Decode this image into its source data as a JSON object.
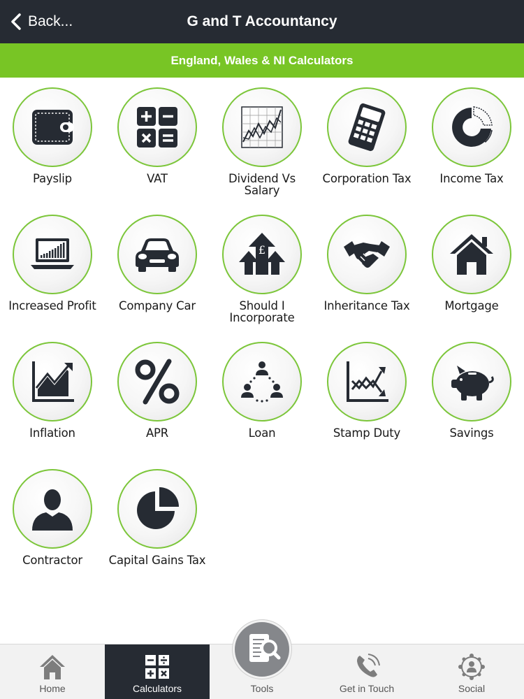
{
  "header": {
    "back_label": "Back...",
    "title": "G and T Accountancy"
  },
  "section": {
    "title": "England, Wales & NI Calculators"
  },
  "calculators": [
    {
      "label": "Payslip",
      "icon": "wallet-icon"
    },
    {
      "label": "VAT",
      "icon": "calculator-symbols-icon"
    },
    {
      "label": "Dividend Vs Salary",
      "icon": "line-chart-icon"
    },
    {
      "label": "Corporation Tax",
      "icon": "calculator-icon"
    },
    {
      "label": "Income Tax",
      "icon": "donut-chart-icon"
    },
    {
      "label": "Increased Profit",
      "icon": "laptop-chart-icon"
    },
    {
      "label": "Company Car",
      "icon": "car-icon"
    },
    {
      "label": "Should I Incorporate",
      "icon": "pound-arrows-icon"
    },
    {
      "label": "Inheritance Tax",
      "icon": "handshake-icon"
    },
    {
      "label": "Mortgage",
      "icon": "house-icon"
    },
    {
      "label": "Inflation",
      "icon": "rising-graph-icon"
    },
    {
      "label": "APR",
      "icon": "percent-icon"
    },
    {
      "label": "Loan",
      "icon": "people-network-icon"
    },
    {
      "label": "Stamp Duty",
      "icon": "crossing-graph-icon"
    },
    {
      "label": "Savings",
      "icon": "piggy-bank-icon"
    },
    {
      "label": "Contractor",
      "icon": "person-icon"
    },
    {
      "label": "Capital Gains Tax",
      "icon": "pie-chart-icon"
    }
  ],
  "tabbar": {
    "tabs": [
      {
        "label": "Home",
        "icon": "house-icon",
        "active": false
      },
      {
        "label": "Calculators",
        "icon": "calculator-symbols-icon",
        "active": true
      },
      {
        "label": "Tools",
        "icon": "document-search-icon",
        "active": false
      },
      {
        "label": "Get in Touch",
        "icon": "phone-icon",
        "active": false
      },
      {
        "label": "Social",
        "icon": "network-icon",
        "active": false
      }
    ]
  },
  "colors": {
    "header_bg": "#262b33",
    "accent_green": "#78c525",
    "icon_dark": "#262b33",
    "tab_bg": "#f2f2f2"
  }
}
